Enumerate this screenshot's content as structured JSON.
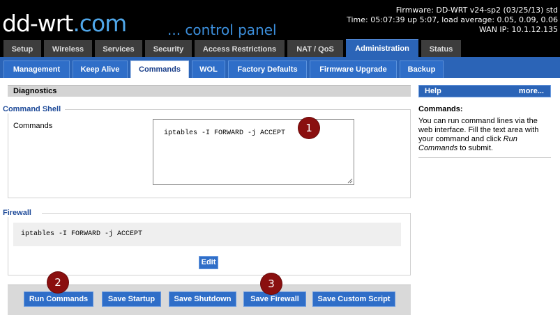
{
  "header": {
    "logo_main": "dd-wrt",
    "logo_suffix": ".com",
    "subtitle": "... control panel",
    "firmware": "Firmware: DD-WRT v24-sp2 (03/25/13) std",
    "time": "Time: 05:07:39 up 5:07, load average: 0.05, 0.09, 0.06",
    "wan_ip": "WAN IP: 10.1.12.135"
  },
  "main_tabs": [
    {
      "label": "Setup"
    },
    {
      "label": "Wireless"
    },
    {
      "label": "Services"
    },
    {
      "label": "Security"
    },
    {
      "label": "Access Restrictions"
    },
    {
      "label": "NAT / QoS"
    },
    {
      "label": "Administration",
      "active": true
    },
    {
      "label": "Status"
    }
  ],
  "sub_tabs": [
    {
      "label": "Management"
    },
    {
      "label": "Keep Alive"
    },
    {
      "label": "Commands",
      "active": true
    },
    {
      "label": "WOL"
    },
    {
      "label": "Factory Defaults"
    },
    {
      "label": "Firmware Upgrade"
    },
    {
      "label": "Backup"
    }
  ],
  "main": {
    "section_title": "Diagnostics",
    "command_shell": {
      "legend": "Command Shell",
      "label": "Commands",
      "value": "iptables -I FORWARD -j ACCEPT"
    },
    "firewall": {
      "legend": "Firewall",
      "content": "iptables -I FORWARD -j ACCEPT",
      "edit_label": "Edit"
    },
    "buttons": {
      "run": "Run Commands",
      "save_startup": "Save Startup",
      "save_shutdown": "Save Shutdown",
      "save_firewall": "Save Firewall",
      "save_custom": "Save Custom Script"
    },
    "markers": [
      "1",
      "2",
      "3"
    ]
  },
  "help": {
    "title": "Help",
    "more": "more...",
    "heading": "Commands:",
    "text_1": "You can run command lines via the web interface. Fill the text area with your command and click ",
    "text_em": "Run Commands",
    "text_2": " to submit."
  },
  "colors": {
    "header_bg": "#000000",
    "accent_blue": "#2b64b7",
    "marker_red": "#8a0f0f"
  }
}
